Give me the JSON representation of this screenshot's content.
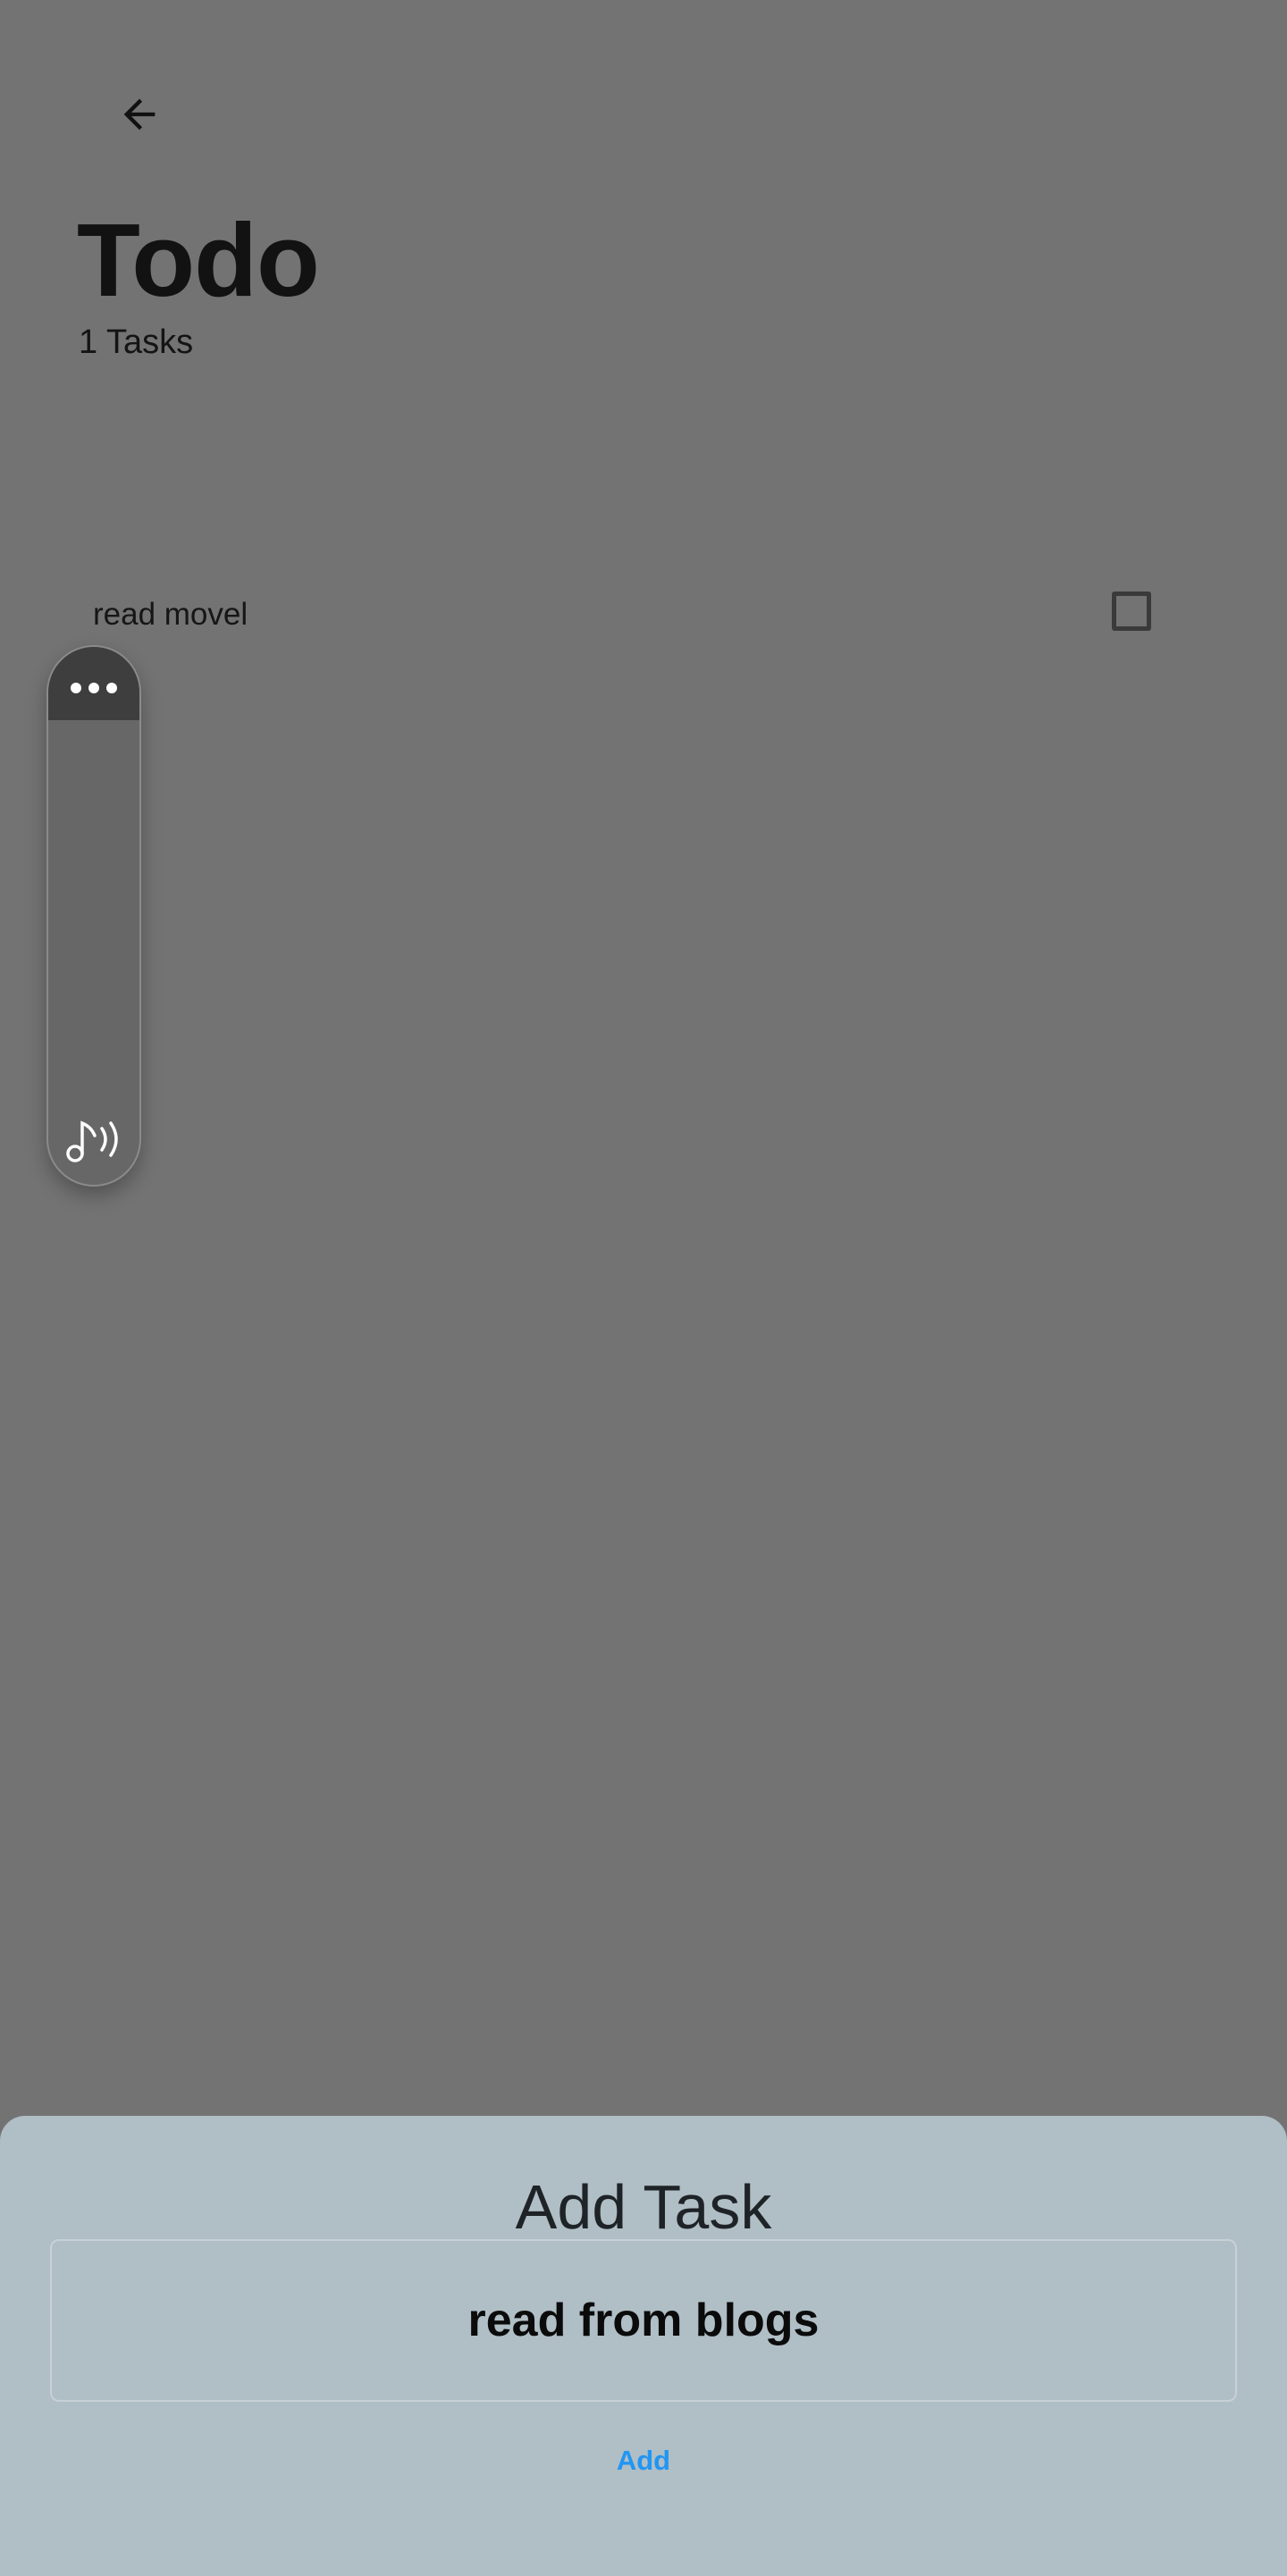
{
  "header": {
    "back_icon": "arrow-left-icon",
    "title": "Todo",
    "count_text": "1 Tasks"
  },
  "tasks": [
    {
      "label": "read movel",
      "checked": false
    }
  ],
  "side_panel": {
    "top_icon": "more-horizontal-icon",
    "bottom_icon": "music-note-sound-icon"
  },
  "sheet": {
    "title": "Add Task",
    "input_value": "read from blogs",
    "add_label": "Add"
  },
  "colors": {
    "scrim_background": "#737373",
    "sheet_background": "#b0bec5",
    "accent": "#2196f3"
  }
}
